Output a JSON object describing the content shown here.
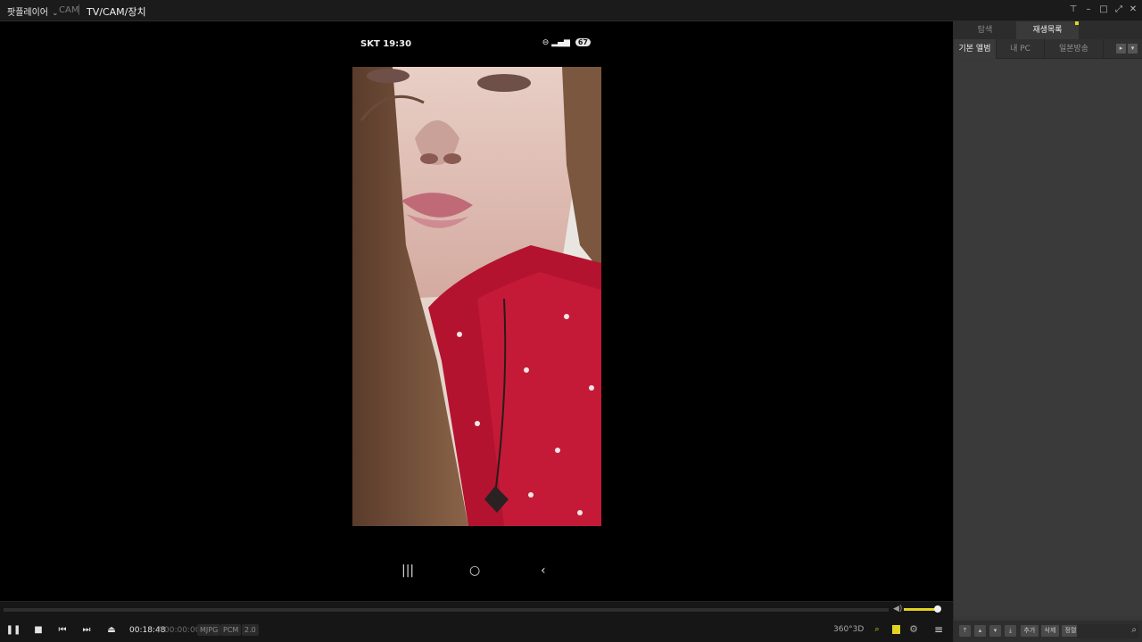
{
  "titlebar": {
    "app_menu": "팟플레이어",
    "crumb_cam": "CAM",
    "crumb_page": "TV/CAM/장치",
    "window_buttons": [
      "pin-icon",
      "minimize-icon",
      "maximize-icon",
      "fullscreen-icon",
      "close-icon"
    ]
  },
  "video": {
    "status_left": "SKT 19:30",
    "battery": "67",
    "nav_buttons": [
      "recent-apps-icon",
      "home-icon",
      "back-icon"
    ]
  },
  "controls": {
    "time_now": "00:18:48",
    "time_sep": "/",
    "time_total": "00:00:00",
    "codecs": [
      "MJPG",
      "PCM",
      "2.0"
    ],
    "right_labels": [
      "360°",
      "3D"
    ],
    "volume_level": 0.9,
    "accent": "#e2d323"
  },
  "panel": {
    "tabs": [
      "탐색",
      "재생목록"
    ],
    "subtabs": [
      "기본 앨범",
      "내 PC",
      "일본방송"
    ],
    "bottom_buttons": [
      "추가",
      "삭제",
      "정렬"
    ]
  }
}
